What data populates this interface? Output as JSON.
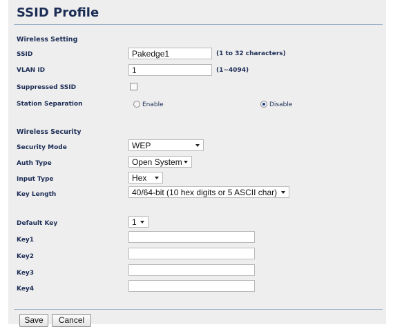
{
  "page": {
    "title": "SSID Profile"
  },
  "wireless_setting": {
    "heading": "Wireless Setting",
    "ssid": {
      "label": "SSID",
      "value": "Pakedge1",
      "hint": "(1 to 32 characters)"
    },
    "vlan_id": {
      "label": "VLAN ID",
      "value": "1",
      "hint": "(1~4094)"
    },
    "suppressed_ssid": {
      "label": "Suppressed SSID",
      "checked": false
    },
    "station_separation": {
      "label": "Station Separation",
      "options": [
        "Enable",
        "Disable"
      ],
      "selected": "Disable"
    }
  },
  "wireless_security": {
    "heading": "Wireless Security",
    "security_mode": {
      "label": "Security Mode",
      "value": "WEP"
    },
    "auth_type": {
      "label": "Auth Type",
      "value": "Open System"
    },
    "input_type": {
      "label": "Input Type",
      "value": "Hex"
    },
    "key_length": {
      "label": "Key Length",
      "value": "40/64-bit (10 hex digits or 5 ASCII char)"
    },
    "default_key": {
      "label": "Default Key",
      "value": "1"
    },
    "keys": [
      {
        "label": "Key1",
        "value": ""
      },
      {
        "label": "Key2",
        "value": ""
      },
      {
        "label": "Key3",
        "value": ""
      },
      {
        "label": "Key4",
        "value": ""
      }
    ]
  },
  "actions": {
    "save_label": "Save",
    "cancel_label": "Cancel"
  },
  "colors": {
    "panel_bg": "#eeeeee",
    "label_text": "#1c2d55",
    "rule": "#9fb3c8"
  }
}
